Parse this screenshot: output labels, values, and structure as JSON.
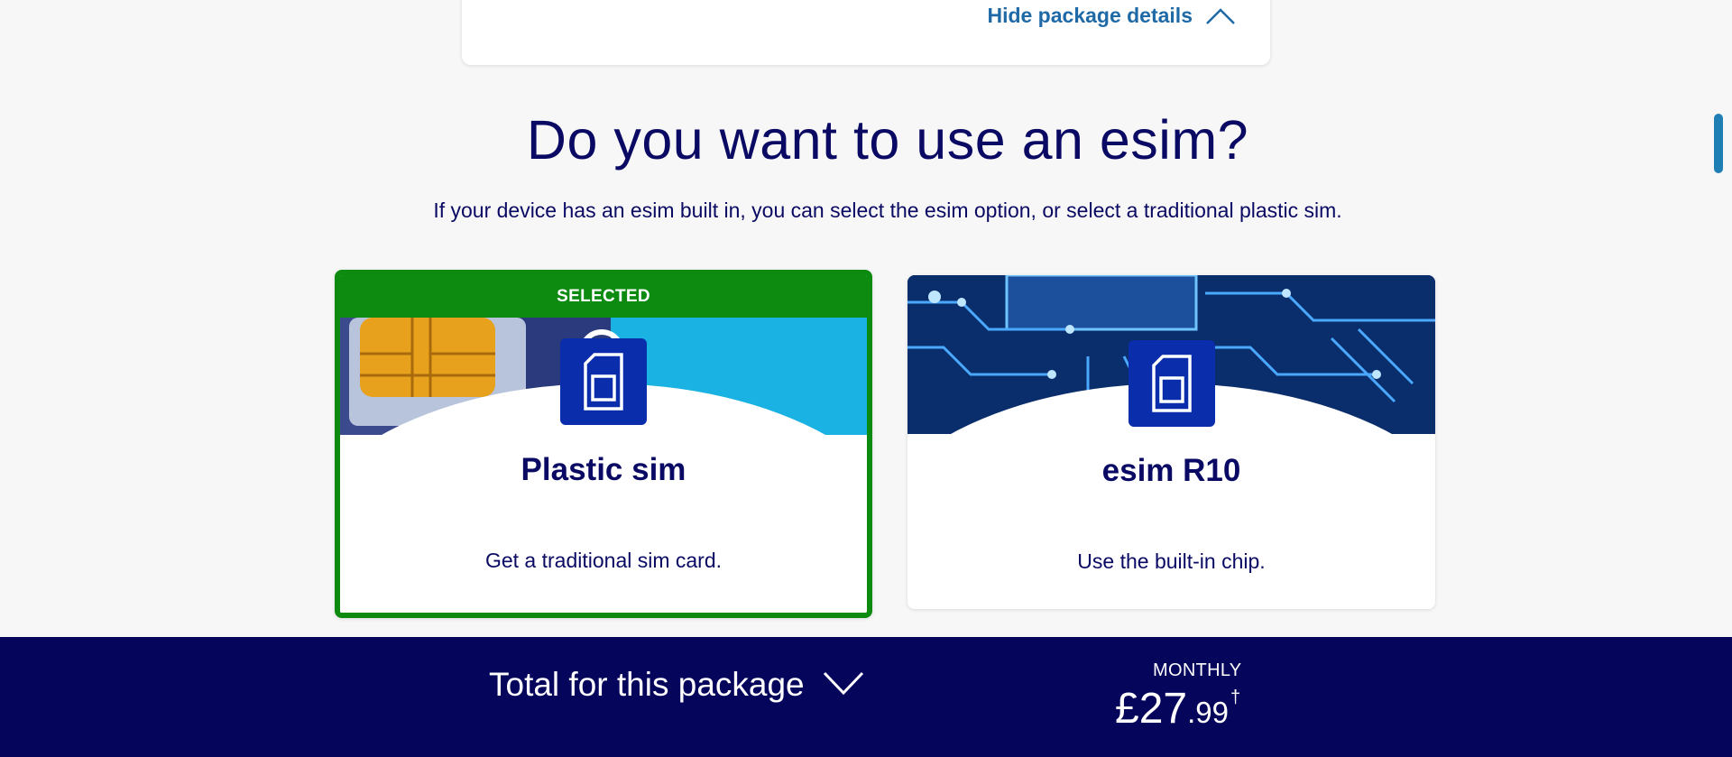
{
  "package_details": {
    "toggle_label": "Hide package details",
    "icon": "chevron-up-icon"
  },
  "main": {
    "title": "Do you want to use an esim?",
    "subtitle": "If your device has an esim built in, you can select the esim option, or select a traditional plastic sim."
  },
  "options": [
    {
      "badge": "SELECTED",
      "title": "Plastic sim",
      "description": "Get a traditional sim card.",
      "icon": "sim-card-icon",
      "selected": true
    },
    {
      "title": "esim R10",
      "description": "Use the built-in chip.",
      "icon": "sim-card-icon",
      "selected": false
    }
  ],
  "footer": {
    "total_label": "Total for this package",
    "toggle_icon": "chevron-down-icon",
    "period_label": "MONTHLY",
    "price_main": "£27",
    "price_pence": ".99",
    "price_mark": "†"
  },
  "colors": {
    "navy": "#0a0a64",
    "footer_bg": "#05055c",
    "selected_green": "#0d8a10",
    "link_blue": "#1f6aa6",
    "badge_blue": "#0a2dab"
  }
}
